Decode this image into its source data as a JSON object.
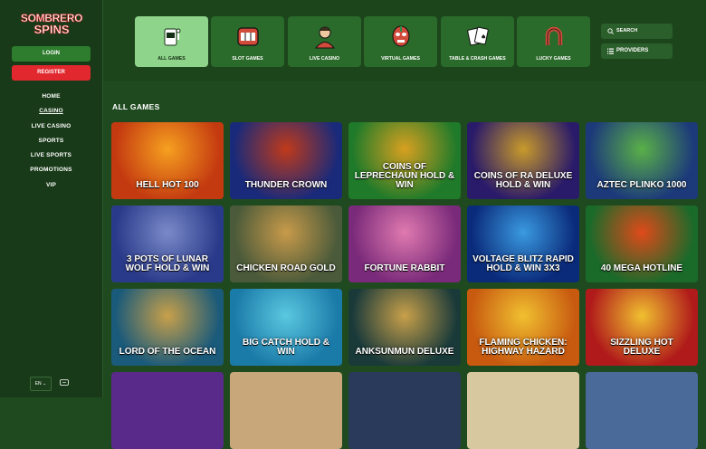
{
  "brand": {
    "line1": "SOMBRERO",
    "line2": "SPINS"
  },
  "auth": {
    "login": "LOGIN",
    "register": "REGISTER"
  },
  "nav": [
    "HOME",
    "CASINO",
    "LIVE CASINO",
    "SPORTS",
    "LIVE SPORTS",
    "PROMOTIONS",
    "VIP"
  ],
  "nav_active": "CASINO",
  "categories": [
    {
      "label": "ALL GAMES",
      "icon": "slot-machine-icon",
      "active": true
    },
    {
      "label": "SLOT GAMES",
      "icon": "slot-reels-icon"
    },
    {
      "label": "LIVE CASINO",
      "icon": "dealer-icon"
    },
    {
      "label": "VIRTUAL GAMES",
      "icon": "wrestler-mask-icon"
    },
    {
      "label": "TABLE & CRASH GAMES",
      "icon": "playing-cards-icon"
    },
    {
      "label": "LUCKY GAMES",
      "icon": "horseshoe-icon"
    }
  ],
  "search": {
    "label": "SEARCH"
  },
  "providers": {
    "label": "PROVIDERS"
  },
  "section": {
    "title": "ALL GAMES"
  },
  "games": [
    {
      "title": "HELL HOT 100",
      "bg": "#c43a10",
      "bg2": "#f6a020"
    },
    {
      "title": "THUNDER CROWN",
      "bg": "#1a2a7a",
      "bg2": "#c03a1a"
    },
    {
      "title": "COINS OF LEPRECHAUN HOLD & WIN",
      "bg": "#1f7a2a",
      "bg2": "#d8a020"
    },
    {
      "title": "COINS OF RA DELUXE HOLD & WIN",
      "bg": "#2a1a6a",
      "bg2": "#c89a2a"
    },
    {
      "title": "AZTEC PLINKO 1000",
      "bg": "#1c3a7a",
      "bg2": "#5ab048"
    },
    {
      "title": "3 POTS OF LUNAR WOLF HOLD & WIN",
      "bg": "#2a3a8a",
      "bg2": "#7a8ac8"
    },
    {
      "title": "CHICKEN ROAD GOLD",
      "bg": "#4a5a3a",
      "bg2": "#c89a4a"
    },
    {
      "title": "FORTUNE RABBIT",
      "bg": "#7a2a7a",
      "bg2": "#e07ab0"
    },
    {
      "title": "VOLTAGE BLITZ RAPID HOLD & WIN 3X3",
      "bg": "#0a2a7a",
      "bg2": "#3a9ae0"
    },
    {
      "title": "40 MEGA HOTLINE",
      "bg": "#1a6a2a",
      "bg2": "#e04a1a"
    },
    {
      "title": "LORD OF THE OCEAN",
      "bg": "#1a5a7a",
      "bg2": "#c8a04a"
    },
    {
      "title": "BIG CATCH HOLD & WIN",
      "bg": "#1a7aa8",
      "bg2": "#5ac8e0"
    },
    {
      "title": "ANKSUNMUN DELUXE",
      "bg": "#1a3a3a",
      "bg2": "#c8a04a"
    },
    {
      "title": "FLAMING CHICKEN: HIGHWAY HAZARD",
      "bg": "#c85a10",
      "bg2": "#f0c030"
    },
    {
      "title": "SIZZLING HOT DELUXE",
      "bg": "#b01a1a",
      "bg2": "#f0c030"
    }
  ],
  "footer": {
    "lang": "EN"
  }
}
